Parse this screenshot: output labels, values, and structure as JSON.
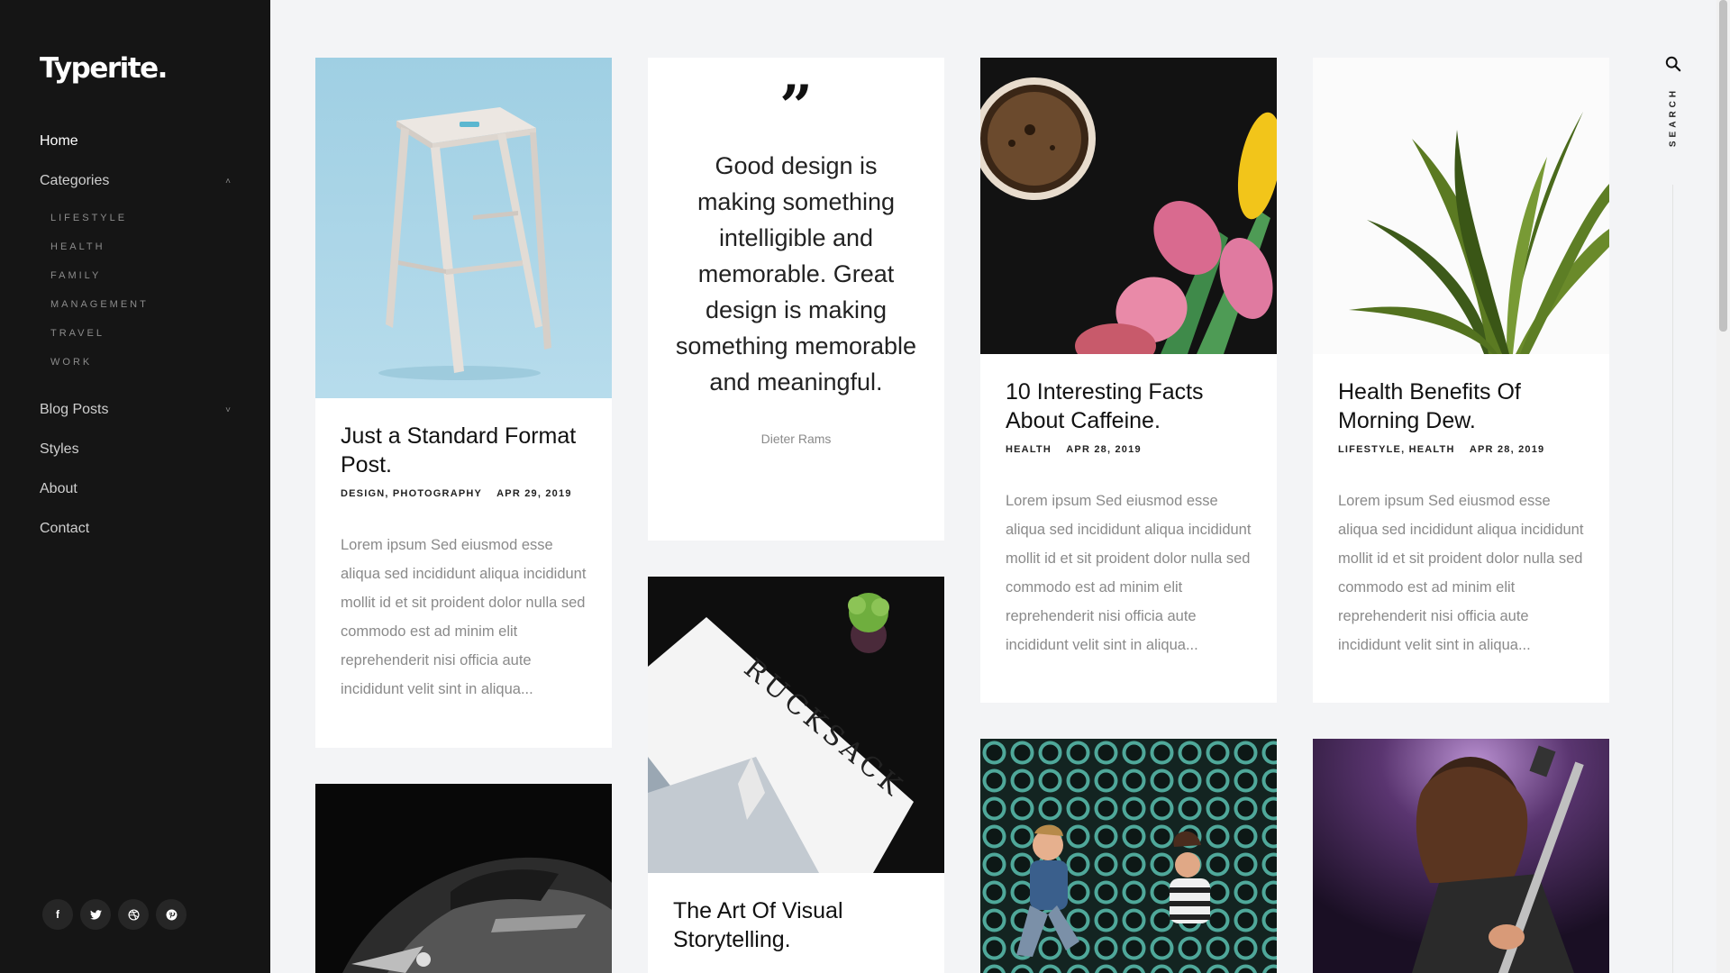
{
  "brand": {
    "logo": "Typerite."
  },
  "nav": {
    "home": "Home",
    "categories": "Categories",
    "categories_toggle": "˄",
    "categories_sub": [
      "LIFESTYLE",
      "HEALTH",
      "FAMILY",
      "MANAGEMENT",
      "TRAVEL",
      "WORK"
    ],
    "blog_posts": "Blog Posts",
    "blog_toggle": "˅",
    "styles": "Styles",
    "about": "About",
    "contact": "Contact"
  },
  "social": {
    "facebook": "f",
    "twitter": "t",
    "dribbble": "d",
    "pinterest": "p"
  },
  "rail": {
    "search_label": "SEARCH"
  },
  "cards": {
    "standard": {
      "title": "Just a Standard Format Post.",
      "cat1": "DESIGN",
      "cat2": "PHOTOGRAPHY",
      "date": "APR 29, 2019",
      "excerpt": "Lorem ipsum Sed eiusmod esse aliqua sed incididunt aliqua incididunt mollit id et sit proident dolor nulla sed commodo est ad minim elit reprehenderit nisi officia aute incididunt velit sint in aliqua..."
    },
    "quote": {
      "mark": "”",
      "text": "Good design is making something intelligible and memorable. Great design is making something memorable and meaningful.",
      "author": "Dieter Rams"
    },
    "caffeine": {
      "title": "10 Interesting Facts About Caffeine.",
      "cat1": "HEALTH",
      "date": "APR 28, 2019",
      "excerpt": "Lorem ipsum Sed eiusmod esse aliqua sed incididunt aliqua incididunt mollit id et sit proident dolor nulla sed commodo est ad minim elit reprehenderit nisi officia aute incididunt velit sint in aliqua..."
    },
    "dew": {
      "title": "Health Benefits Of Morning Dew.",
      "cat1": "LIFESTYLE",
      "cat2": "HEALTH",
      "date": "APR 28, 2019",
      "excerpt": "Lorem ipsum Sed eiusmod esse aliqua sed incididunt aliqua incididunt mollit id et sit proident dolor nulla sed commodo est ad minim elit reprehenderit nisi officia aute incididunt velit sint in aliqua..."
    },
    "visual": {
      "title": "The Art Of Visual Storytelling.",
      "magazine_word": "RUCKSACK"
    }
  },
  "colors": {
    "sidebar": "#151515",
    "page": "#f3f4f6",
    "stool_bg": "#a9d4e6"
  }
}
